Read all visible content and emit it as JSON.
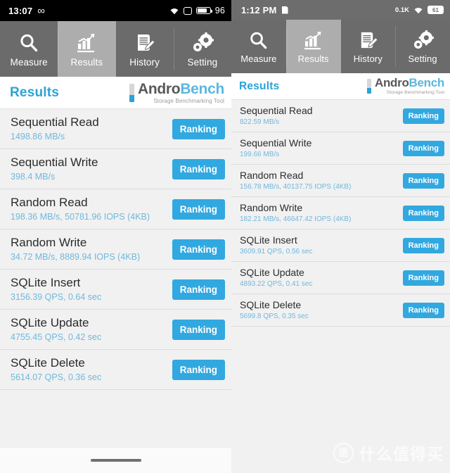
{
  "left_phone": {
    "statusbar": {
      "time": "13:07",
      "infinity_icon": "infinity-icon",
      "wifi_icon": "wifi-icon",
      "square_icon": "rounded-square-icon",
      "battery_icon": "battery-icon",
      "battery_level": "96"
    },
    "tabs": [
      {
        "label": "Measure",
        "icon": "magnifier-icon",
        "active": false
      },
      {
        "label": "Results",
        "icon": "bar-chart-icon",
        "active": true
      },
      {
        "label": "History",
        "icon": "document-pencil-icon",
        "active": false
      },
      {
        "label": "Setting",
        "icon": "gears-icon",
        "active": false
      }
    ],
    "header": {
      "title": "Results",
      "logo_andro": "Andro",
      "logo_bench": "Bench",
      "logo_tagline": "Storage Benchmarking Tool"
    },
    "results": [
      {
        "name": "Sequential Read",
        "value": "1498.86 MB/s",
        "button": "Ranking"
      },
      {
        "name": "Sequential Write",
        "value": "398.4 MB/s",
        "button": "Ranking"
      },
      {
        "name": "Random Read",
        "value": "198.36 MB/s, 50781.96 IOPS (4KB)",
        "button": "Ranking"
      },
      {
        "name": "Random Write",
        "value": "34.72 MB/s, 8889.94 IOPS (4KB)",
        "button": "Ranking"
      },
      {
        "name": "SQLite Insert",
        "value": "3156.39 QPS, 0.64 sec",
        "button": "Ranking"
      },
      {
        "name": "SQLite Update",
        "value": "4755.45 QPS, 0.42 sec",
        "button": "Ranking"
      },
      {
        "name": "SQLite Delete",
        "value": "5614.07 QPS, 0.36 sec",
        "button": "Ranking"
      }
    ],
    "navbar": {
      "home_indicator": "home-indicator"
    }
  },
  "right_phone": {
    "statusbar": {
      "time": "1:12 PM",
      "doc_icon": "document-icon",
      "data_rate": "0.1K",
      "wifi_icon": "wifi-icon",
      "battery_level": "61"
    },
    "tabs": [
      {
        "label": "Measure",
        "icon": "magnifier-icon",
        "active": false
      },
      {
        "label": "Results",
        "icon": "bar-chart-icon",
        "active": true
      },
      {
        "label": "History",
        "icon": "document-pencil-icon",
        "active": false
      },
      {
        "label": "Setting",
        "icon": "gears-icon",
        "active": false
      }
    ],
    "header": {
      "title": "Results",
      "logo_andro": "Andro",
      "logo_bench": "Bench",
      "logo_tagline": "Storage Benchmarking Tool"
    },
    "results": [
      {
        "name": "Sequential Read",
        "value": "822.59 MB/s",
        "button": "Ranking"
      },
      {
        "name": "Sequential Write",
        "value": "199.66 MB/s",
        "button": "Ranking"
      },
      {
        "name": "Random Read",
        "value": "156.78 MB/s, 40137.75 IOPS (4KB)",
        "button": "Ranking"
      },
      {
        "name": "Random Write",
        "value": "182.21 MB/s, 46647.42 IOPS (4KB)",
        "button": "Ranking"
      },
      {
        "name": "SQLite Insert",
        "value": "3609.91 QPS, 0.56 sec",
        "button": "Ranking"
      },
      {
        "name": "SQLite Update",
        "value": "4893.22 QPS, 0.41 sec",
        "button": "Ranking"
      },
      {
        "name": "SQLite Delete",
        "value": "5699.8 QPS, 0.35 sec",
        "button": "Ranking"
      }
    ]
  },
  "watermark": {
    "badge": "值",
    "text": "什么值得买"
  },
  "colors": {
    "accent_blue": "#32a8e0",
    "title_blue": "#2aa3d6",
    "value_blue": "#6fb8dd",
    "tabbar_gray": "#6b6b6b",
    "tab_active_gray": "#adadad",
    "list_bg": "#f1f1f1"
  }
}
